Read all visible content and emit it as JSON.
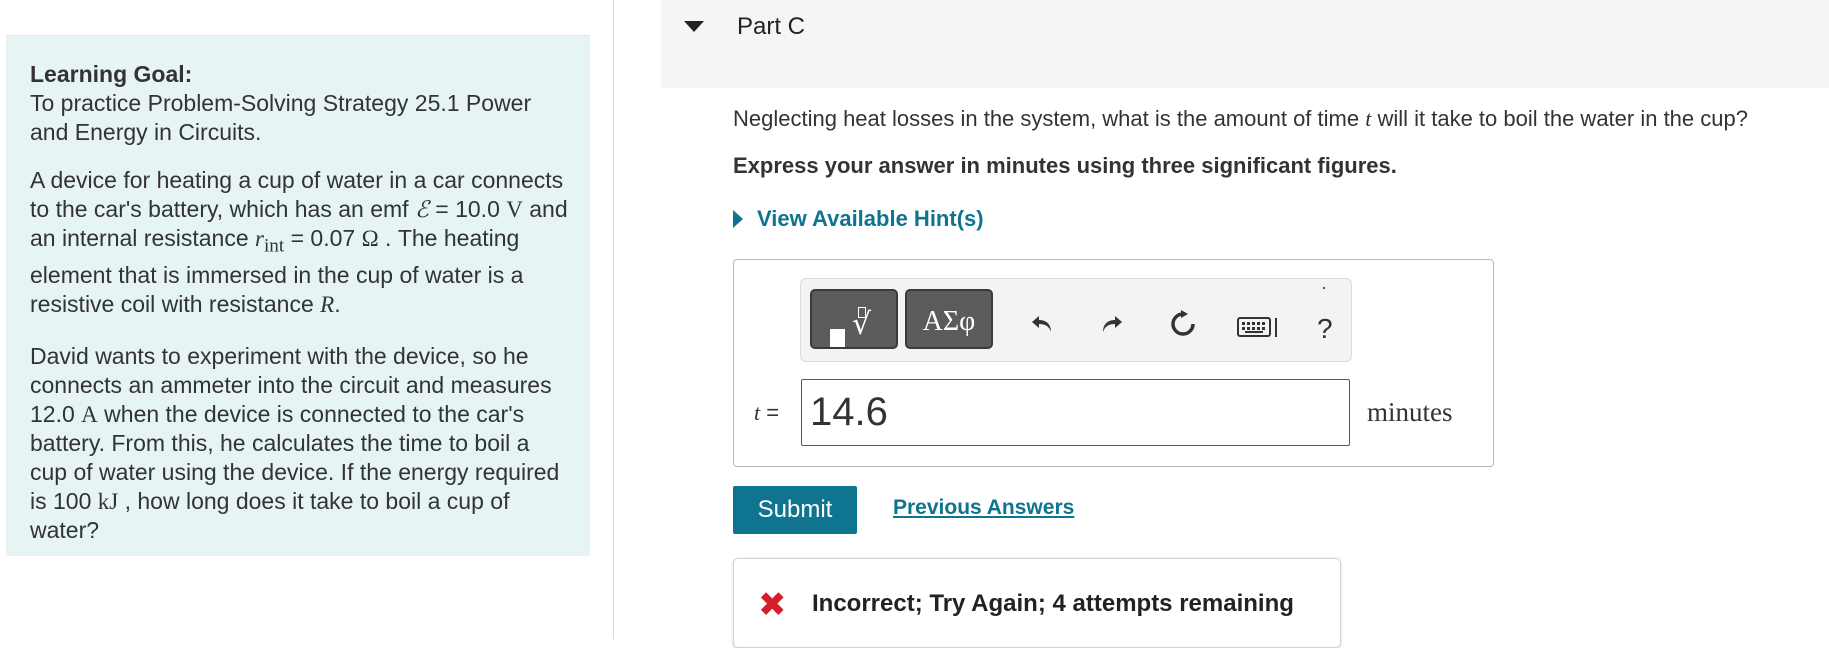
{
  "left_panel": {
    "goal_label": "Learning Goal:",
    "goal_text": "To practice Problem-Solving Strategy 25.1 Power and Energy in Circuits.",
    "p1": {
      "t1": "A device for heating a cup of water in a car connects to the car's battery, which has an emf ",
      "emf_symbol": "ℰ",
      "t2": " = ",
      "emf_value": "10.0",
      "emf_unit": "V",
      "t3": " and an internal resistance ",
      "r_symbol": "r",
      "r_sub": "int",
      "t4": " = 0.07 ",
      "r_unit": "Ω",
      "t5": " . The heating element that is immersed in the cup of water is a resistive coil with resistance ",
      "R_symbol": "R",
      "t6": "."
    },
    "p2": {
      "t1": "David wants to experiment with the device, so he connects an ammeter into the circuit and measures ",
      "current_value": "12.0",
      "current_unit": "A",
      "t2": " when the device is connected to the car's battery. From this, he calculates the time to boil a cup of water using the device. If the energy required is 100 ",
      "energy_unit": "kJ",
      "t3": " , how long does it take to boil a cup of water?"
    }
  },
  "part": {
    "title": "Part C",
    "question_before": "Neglecting heat losses in the system, what is the amount of time ",
    "question_var": "t",
    "question_after": " will it take to boil the water in the cup?",
    "instruction": "Express your answer in minutes using three significant figures.",
    "hint_label": "View Available Hint(s)"
  },
  "toolbar": {
    "symbols_label": "ΑΣφ",
    "undo_icon": "undo-icon",
    "redo_icon": "redo-icon",
    "reset_icon": "reset-icon",
    "keyboard_icon": "keyboard-icon",
    "help_label": "?"
  },
  "answer": {
    "variable_label": "t =",
    "value": "14.6",
    "unit": "minutes"
  },
  "actions": {
    "submit_label": "Submit",
    "previous_answers_label": "Previous Answers"
  },
  "feedback": {
    "icon": "x-icon",
    "text": "Incorrect; Try Again; 4 attempts remaining",
    "color": "#d41f2b"
  },
  "colors": {
    "accent": "#0e7490",
    "panel_bg": "#e6f4f4",
    "header_bg": "#f5f5f5"
  }
}
